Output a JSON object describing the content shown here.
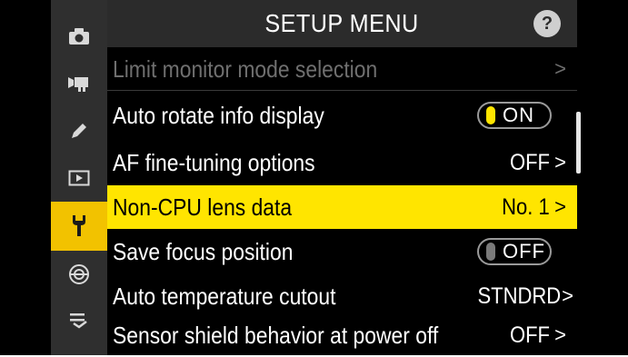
{
  "header": {
    "title": "SETUP MENU",
    "help_label": "?"
  },
  "sidebar": {
    "items": [
      {
        "icon": "camera-icon",
        "active": false
      },
      {
        "icon": "movie-camera-icon",
        "active": false
      },
      {
        "icon": "pencil-icon",
        "active": false
      },
      {
        "icon": "playback-icon",
        "active": false
      },
      {
        "icon": "wrench-icon",
        "active": true
      },
      {
        "icon": "network-icon",
        "active": false
      },
      {
        "icon": "my-menu-icon",
        "active": false
      }
    ]
  },
  "menu": {
    "items": [
      {
        "label": "Limit monitor mode selection",
        "value": "",
        "chevron": ">",
        "state": "disabled"
      },
      {
        "label": "Auto rotate info display",
        "toggle": "ON",
        "state": "normal"
      },
      {
        "label": "AF fine-tuning options",
        "value": "OFF",
        "chevron": ">",
        "state": "normal"
      },
      {
        "label": "Non-CPU lens data",
        "value": "No. 1",
        "chevron": ">",
        "state": "selected"
      },
      {
        "label": "Save focus position",
        "toggle": "OFF",
        "state": "normal"
      },
      {
        "label": "Auto temperature cutout",
        "value": "STNDRD",
        "chevron": ">",
        "state": "normal"
      },
      {
        "label": "Sensor shield behavior at power off",
        "value": "OFF",
        "chevron": ">",
        "state": "normal"
      }
    ]
  },
  "colors": {
    "accent": "#ffe500",
    "sidebar_active": "#f2c200",
    "background": "#000000"
  }
}
